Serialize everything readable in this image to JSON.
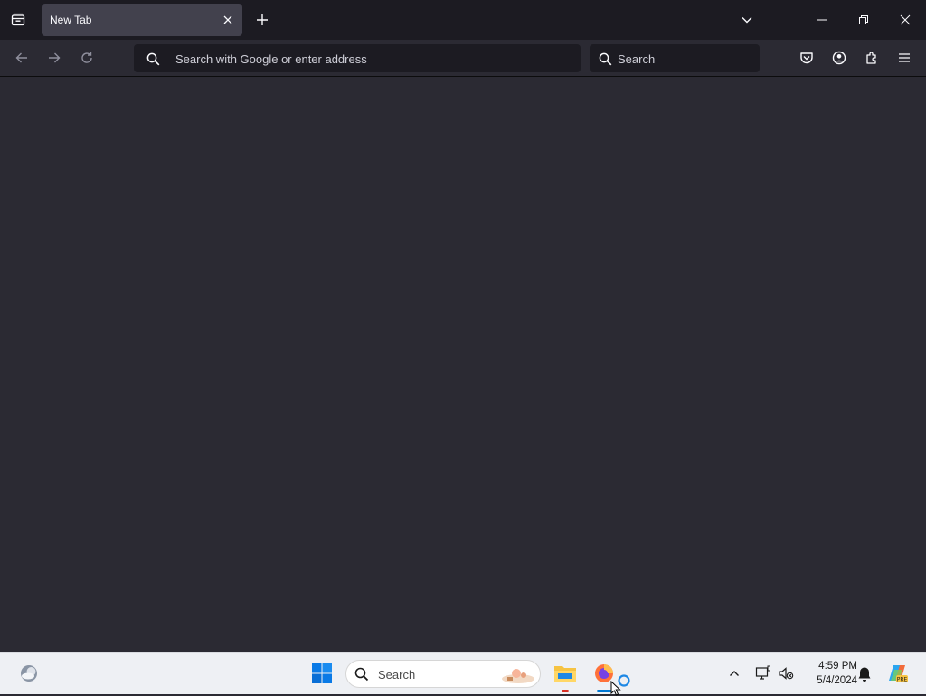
{
  "browser": {
    "tab": {
      "title": "New Tab"
    },
    "urlbar": {
      "placeholder": "Search with Google or enter address"
    },
    "searchbar": {
      "placeholder": "Search"
    }
  },
  "taskbar": {
    "search_label": "Search",
    "time": "4:59 PM",
    "date": "5/4/2024"
  },
  "colors": {
    "tabbar_bg": "#1c1b22",
    "toolbar_bg": "#2b2a33",
    "active_tab_bg": "#42414d",
    "taskbar_bg": "#eef0f4",
    "accent_windows": "#0078d4"
  },
  "icons": {
    "tab_overview": "firefox-view-icon",
    "new_tab": "plus-icon",
    "list_all_tabs": "chevron-down-icon",
    "minimize": "minimize-icon",
    "restore": "restore-icon",
    "close": "close-icon",
    "back": "back-arrow-icon",
    "forward": "forward-arrow-icon",
    "reload": "reload-icon",
    "pocket": "pocket-icon",
    "account": "account-icon",
    "extensions": "puzzle-icon",
    "menu": "hamburger-menu-icon"
  }
}
